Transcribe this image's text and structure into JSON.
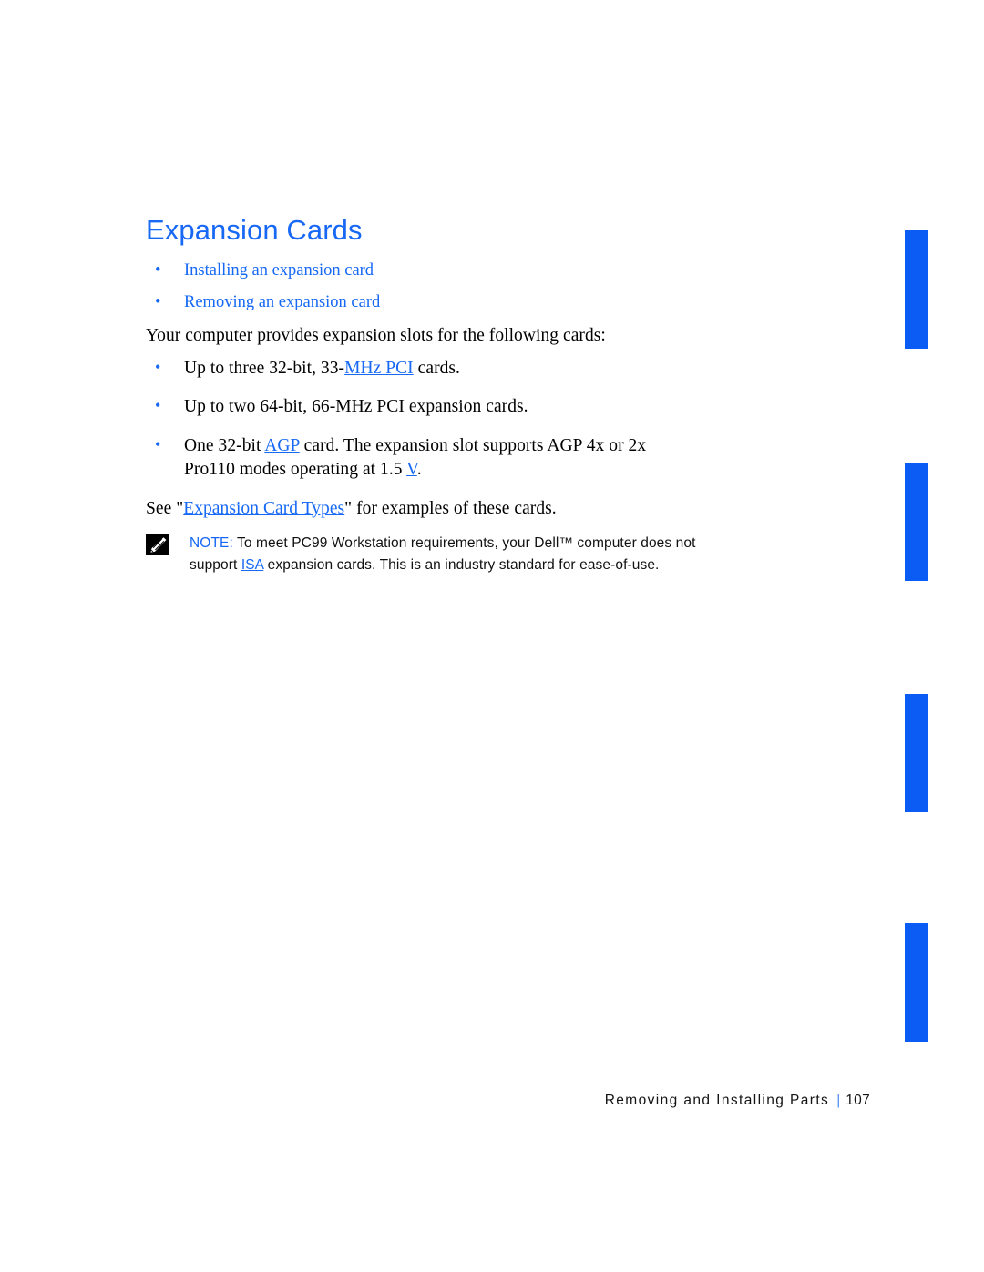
{
  "document": {
    "title": "Expansion Cards",
    "page_number": "107",
    "footer_section": "Removing and Installing Parts",
    "footer_separator": "|"
  },
  "colors": {
    "link_blue": "#1668f5",
    "marker_bar_blue": "#0a5cf5",
    "body_black": "#000000",
    "page_background": "#ffffff"
  },
  "heading": {
    "text": "Expansion Cards"
  },
  "topic_links": {
    "bullet_glyph": "•",
    "items": [
      {
        "label": "Installing an expansion card"
      },
      {
        "label": "Removing an expansion card"
      }
    ]
  },
  "intro": {
    "text": "Your computer provides expansion slots for the following cards:"
  },
  "specs": {
    "bullet_glyph": "•",
    "items": [
      {
        "pre": "Up to three 32-bit, 33-",
        "link": "MHz PCI",
        "post": " cards.",
        "line2": ""
      },
      {
        "pre": "Up to two 64-bit, 66-MHz PCI expansion cards.",
        "link": "",
        "post": "",
        "line2": ""
      },
      {
        "pre": "One 32-bit ",
        "link": "AGP",
        "post": " card. The expansion slot supports AGP 4x or 2x",
        "line2_pre": "Pro110 modes operating at 1.5 ",
        "line2_link": "V",
        "line2_post": "."
      }
    ]
  },
  "see_also": {
    "pre": "See \"",
    "link": "Expansion Card Types",
    "post": "\" for examples of these cards."
  },
  "note": {
    "icon_name": "note-pencil-icon",
    "label": "NOTE:",
    "line1_pre": " To meet PC99 Workstation requirements, your Dell™ computer does",
    "line2_pre": "not support ",
    "line2_link": "ISA",
    "line2_post": " expansion cards. This is an industry standard for ease-of-use."
  },
  "edge_markers": {
    "count": 4,
    "description": "blue vertical change bars at right page edge"
  }
}
